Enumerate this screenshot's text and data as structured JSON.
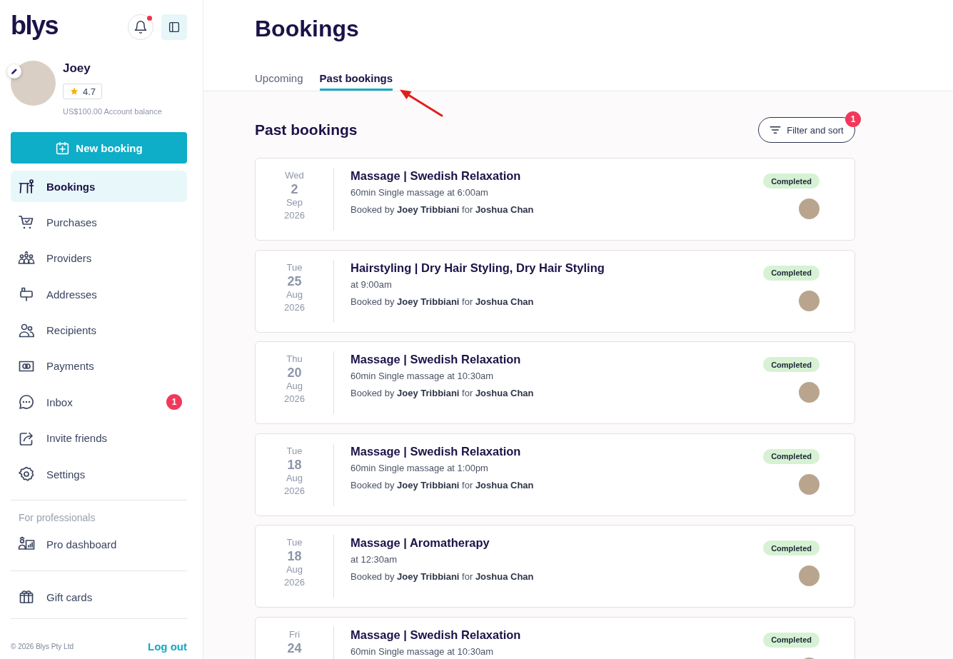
{
  "sidebar": {
    "logo": "blys",
    "notifications": {
      "unread": true
    },
    "profile": {
      "name": "Joey",
      "rating": "4.7",
      "balance": "US$100.00 Account balance"
    },
    "new_booking": "New booking",
    "nav": [
      {
        "label": "Bookings",
        "selected": true
      },
      {
        "label": "Purchases",
        "selected": false
      },
      {
        "label": "Providers",
        "selected": false
      },
      {
        "label": "Addresses",
        "selected": false
      },
      {
        "label": "Recipients",
        "selected": false
      },
      {
        "label": "Payments",
        "selected": false
      },
      {
        "label": "Inbox",
        "selected": false,
        "badge": "1"
      },
      {
        "label": "Invite friends",
        "selected": false
      },
      {
        "label": "Settings",
        "selected": false
      }
    ],
    "professionals": {
      "heading": "For professionals",
      "items": [
        {
          "label": "Pro dashboard",
          "selected": false
        }
      ]
    },
    "more": [
      {
        "label": "Gift cards",
        "selected": false
      }
    ],
    "copyright": "© 2026 Blys Pty Ltd",
    "logout": "Log out"
  },
  "page": {
    "title": "Bookings",
    "tabs": [
      {
        "label": "Upcoming",
        "selected": false
      },
      {
        "label": "Past bookings",
        "selected": true
      }
    ]
  },
  "section": {
    "title": "Past bookings",
    "filter_button": {
      "label": "Filter and sort",
      "badge": "1"
    }
  },
  "bookings": [
    {
      "weekday": "Wed",
      "day": "2",
      "month": "Sep",
      "year": "2026",
      "title": "Massage | Swedish Relaxation",
      "detail": "60min Single massage at 6:00am",
      "byline": "Booked by **Joey Tribbiani** for **Joshua Chan**",
      "status": "Completed"
    },
    {
      "weekday": "Tue",
      "day": "25",
      "month": "Aug",
      "year": "2026",
      "title": "Hairstyling | Dry Hair Styling, Dry Hair Styling",
      "detail": "at 9:00am",
      "byline": "Booked by **Joey Tribbiani** for **Joshua Chan**",
      "status": "Completed"
    },
    {
      "weekday": "Thu",
      "day": "20",
      "month": "Aug",
      "year": "2026",
      "title": "Massage | Swedish Relaxation",
      "detail": "60min Single massage at 10:30am",
      "byline": "Booked by **Joey Tribbiani** for **Joshua Chan**",
      "status": "Completed"
    },
    {
      "weekday": "Tue",
      "day": "18",
      "month": "Aug",
      "year": "2026",
      "title": "Massage | Swedish Relaxation",
      "detail": "60min Single massage at 1:00pm",
      "byline": "Booked by **Joey Tribbiani** for **Joshua Chan**",
      "status": "Completed"
    },
    {
      "weekday": "Tue",
      "day": "18",
      "month": "Aug",
      "year": "2026",
      "title": "Massage | Aromatherapy",
      "detail": "at 12:30am",
      "byline": "Booked by **Joey Tribbiani** for **Joshua Chan**",
      "status": "Completed"
    },
    {
      "weekday": "Fri",
      "day": "24",
      "title": "Massage | Swedish Relaxation",
      "detail": "60min Single massage at 10:30am",
      "status": "Completed"
    }
  ]
}
